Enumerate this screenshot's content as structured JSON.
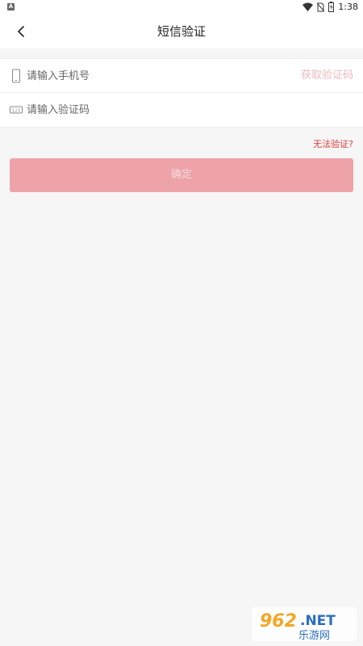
{
  "status_bar": {
    "time": "1:38",
    "left_icon_letter": "A",
    "icons": [
      "wifi-icon",
      "no-sim-icon",
      "battery-icon"
    ]
  },
  "nav": {
    "title": "短信验证",
    "back_icon": "chevron-left-icon"
  },
  "form": {
    "phone": {
      "placeholder": "请输入手机号",
      "value": "",
      "icon": "phone-icon"
    },
    "get_code_label": "获取验证码",
    "code": {
      "placeholder": "请输入验证码",
      "value": "",
      "icon": "keypad-icon",
      "icon_text": "123"
    }
  },
  "cannot_verify_label": "无法验证?",
  "confirm_label": "确定",
  "watermark": {
    "brand_number": "962",
    "brand_suffix": ".NET",
    "brand_cn": "乐游网"
  },
  "colors": {
    "accent_red": "#e23a3a",
    "button_disabled": "#eda3a8",
    "link_disabled": "#f0b8be",
    "background": "#f6f6f6"
  }
}
